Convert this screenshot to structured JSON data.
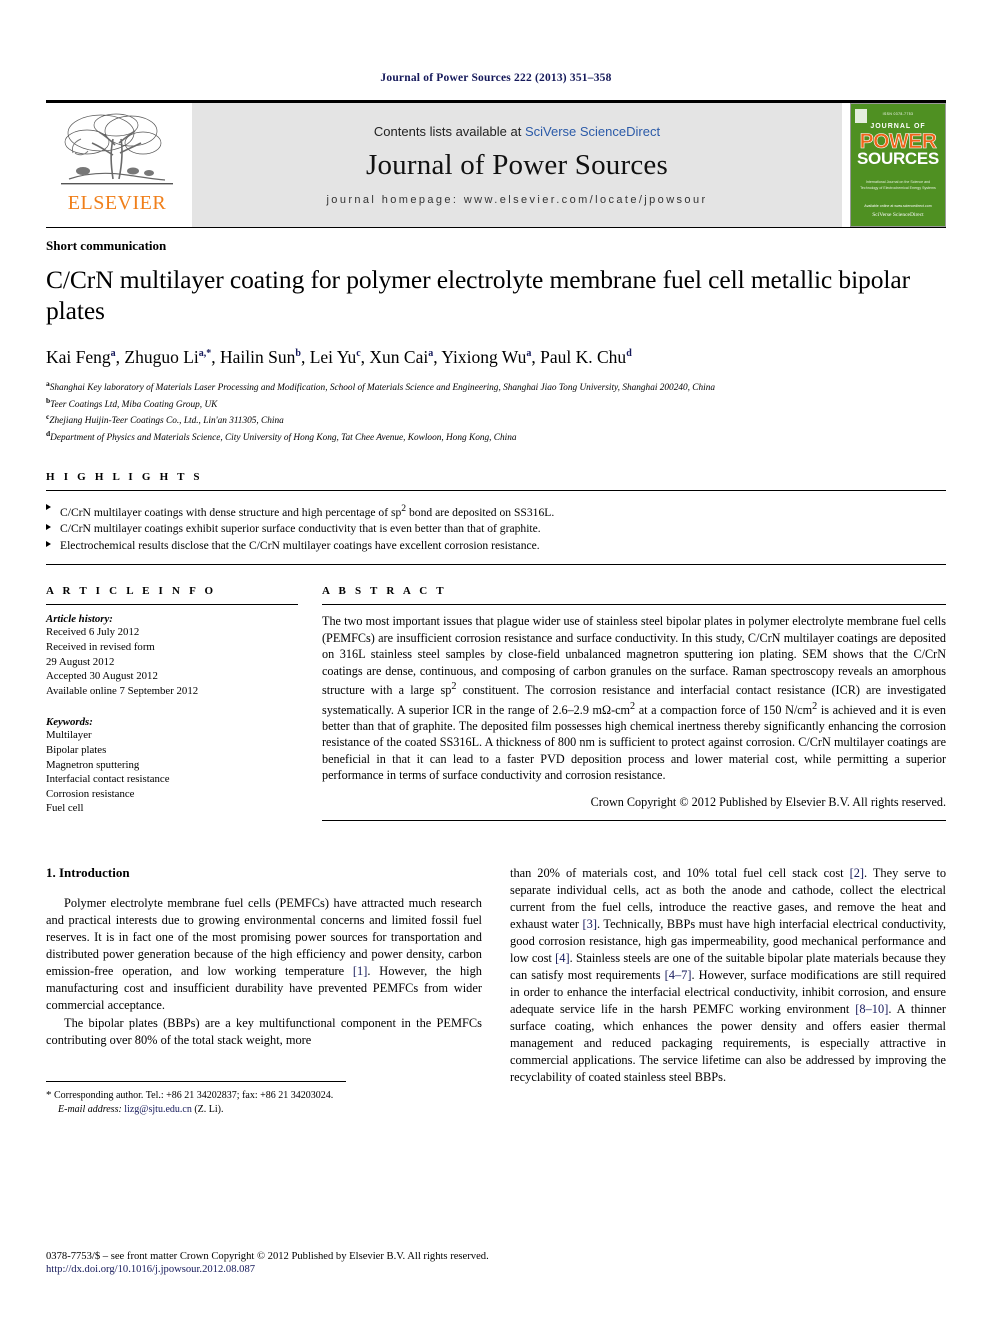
{
  "running_head": "Journal of Power Sources 222 (2013) 351–358",
  "masthead": {
    "publisher_name": "ELSEVIER",
    "contents_prefix": "Contents lists available at ",
    "contents_link": "SciVerse ScienceDirect",
    "journal_title": "Journal of Power Sources",
    "homepage": "journal homepage: www.elsevier.com/locate/jpowsour",
    "cover": {
      "top_text": "ISSN 0378-7753",
      "journal_of": "JOURNAL OF",
      "power": "POWER",
      "sources": "SOURCES",
      "description": "International Journal on the Science and Technology of Electrochemical Energy Systems",
      "footer_line1": "Available online at www.sciencedirect.com",
      "footer_brand": "SciVerse ScienceDirect"
    }
  },
  "article": {
    "doc_type": "Short communication",
    "title": "C/CrN multilayer coating for polymer electrolyte membrane fuel cell metallic bipolar plates",
    "authors": [
      {
        "name": "Kai Feng",
        "sup": "a"
      },
      {
        "name": "Zhuguo Li",
        "sup": "a,*"
      },
      {
        "name": "Hailin Sun",
        "sup": "b"
      },
      {
        "name": "Lei Yu",
        "sup": "c"
      },
      {
        "name": "Xun Cai",
        "sup": "a"
      },
      {
        "name": "Yixiong Wu",
        "sup": "a"
      },
      {
        "name": "Paul K. Chu",
        "sup": "d"
      }
    ],
    "affiliations": [
      {
        "marker": "a",
        "text": "Shanghai Key laboratory of Materials Laser Processing and Modification, School of Materials Science and Engineering, Shanghai Jiao Tong University, Shanghai 200240, China"
      },
      {
        "marker": "b",
        "text": "Teer Coatings Ltd, Miba Coating Group, UK"
      },
      {
        "marker": "c",
        "text": "Zhejiang Huijin-Teer Coatings Co., Ltd., Lin'an 311305, China"
      },
      {
        "marker": "d",
        "text": "Department of Physics and Materials Science, City University of Hong Kong, Tat Chee Avenue, Kowloon, Hong Kong, China"
      }
    ]
  },
  "highlights": {
    "heading": "H I G H L I G H T S",
    "items": [
      "C/CrN multilayer coatings with dense structure and high percentage of sp2 bond are deposited on SS316L.",
      "C/CrN multilayer coatings exhibit superior surface conductivity that is even better than that of graphite.",
      "Electrochemical results disclose that the C/CrN multilayer coatings have excellent corrosion resistance."
    ]
  },
  "article_info": {
    "heading": "A R T I C L E   I N F O",
    "history_label": "Article history:",
    "history": [
      "Received 6 July 2012",
      "Received in revised form",
      "29 August 2012",
      "Accepted 30 August 2012",
      "Available online 7 September 2012"
    ],
    "keywords_label": "Keywords:",
    "keywords": [
      "Multilayer",
      "Bipolar plates",
      "Magnetron sputtering",
      "Interfacial contact resistance",
      "Corrosion resistance",
      "Fuel cell"
    ]
  },
  "abstract": {
    "heading": "A B S T R A C T",
    "body": "The two most important issues that plague wider use of stainless steel bipolar plates in polymer electrolyte membrane fuel cells (PEMFCs) are insufficient corrosion resistance and surface conductivity. In this study, C/CrN multilayer coatings are deposited on 316L stainless steel samples by close-field unbalanced magnetron sputtering ion plating. SEM shows that the C/CrN coatings are dense, continuous, and composing of carbon granules on the surface. Raman spectroscopy reveals an amorphous structure with a large sp2 constituent. The corrosion resistance and interfacial contact resistance (ICR) are investigated systematically. A superior ICR in the range of 2.6–2.9 mΩ-cm2 at a compaction force of 150 N/cm2 is achieved and it is even better than that of graphite. The deposited film possesses high chemical inertness thereby significantly enhancing the corrosion resistance of the coated SS316L. A thickness of 800 nm is sufficient to protect against corrosion. C/CrN multilayer coatings are beneficial in that it can lead to a faster PVD deposition process and lower material cost, while permitting a superior performance in terms of surface conductivity and corrosion resistance.",
    "copyright": "Crown Copyright © 2012 Published by Elsevier B.V. All rights reserved."
  },
  "introduction": {
    "section_number": "1.",
    "section_title": "Introduction",
    "left_paragraph_1": "Polymer electrolyte membrane fuel cells (PEMFCs) have attracted much research and practical interests due to growing environmental concerns and limited fossil fuel reserves. It is in fact one of the most promising power sources for transportation and distributed power generation because of the high efficiency and power density, carbon emission-free operation, and low working temperature [1]. However, the high manufacturing cost and insufficient durability have prevented PEMFCs from wider commercial acceptance.",
    "left_paragraph_2": "The bipolar plates (BBPs) are a key multifunctional component in the PEMFCs contributing over 80% of the total stack weight, more",
    "right_paragraph_1": "than 20% of materials cost, and 10% total fuel cell stack cost [2]. They serve to separate individual cells, act as both the anode and cathode, collect the electrical current from the fuel cells, introduce the reactive gases, and remove the heat and exhaust water [3]. Technically, BBPs must have high interfacial electrical conductivity, good corrosion resistance, high gas impermeability, good mechanical performance and low cost [4]. Stainless steels are one of the suitable bipolar plate materials because they can satisfy most requirements [4–7]. However, surface modifications are still required in order to enhance the interfacial electrical conductivity, inhibit corrosion, and ensure adequate service life in the harsh PEMFC working environment [8–10]. A thinner surface coating, which enhances the power density and offers easier thermal management and reduced packaging requirements, is especially attractive in commercial applications. The service lifetime can also be addressed by improving the recyclability of coated stainless steel BBPs."
  },
  "footnote": {
    "star": "*",
    "corresponding": "Corresponding author. Tel.: +86 21 34202837; fax: +86 21 34203024.",
    "email_label": "E-mail address:",
    "email": "lizg@sjtu.edu.cn",
    "email_suffix": "(Z. Li)."
  },
  "page_footer": {
    "issn_line": "0378-7753/$ – see front matter Crown Copyright © 2012 Published by Elsevier B.V. All rights reserved.",
    "doi": "http://dx.doi.org/10.1016/j.jpowsour.2012.08.087"
  },
  "colors": {
    "link_navy": "#15195a",
    "sciencedirect_blue": "#2b5aa8",
    "elsevier_orange": "#f07f1a",
    "cover_green": "#4f9022",
    "cover_orange": "#f0651a"
  }
}
